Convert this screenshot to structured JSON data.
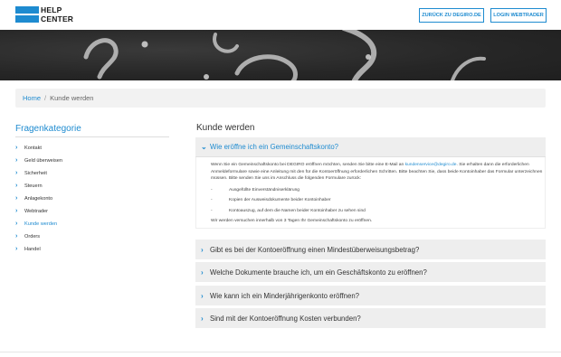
{
  "header": {
    "logo_line1": "HELP",
    "logo_line2": "CENTER",
    "btn_degiro": "ZURÜCK ZU DEGIRO.DE",
    "btn_login": "LOGIN WEBTRADER"
  },
  "breadcrumb": {
    "home": "Home",
    "separator": "/",
    "current": "Kunde werden"
  },
  "sidebar": {
    "title": "Fragenkategorie",
    "items": [
      {
        "label": "Kontakt"
      },
      {
        "label": "Geld überweisen"
      },
      {
        "label": "Sicherheit"
      },
      {
        "label": "Steuern"
      },
      {
        "label": "Anlagekonto"
      },
      {
        "label": "Webtrader"
      },
      {
        "label": "Kunde werden",
        "active": true
      },
      {
        "label": "Orders"
      },
      {
        "label": "Handel"
      }
    ]
  },
  "main": {
    "title": "Kunde werden",
    "faq": [
      {
        "question": "Wie eröffne ich ein Gemeinschaftskonto?",
        "open": true,
        "body_pre": "Wenn Sie ein Gemeinschaftskonto bei DEGIRO eröffnen möchten, senden Sie bitte eine E-Mail an ",
        "email": "kundenservice@degiro.de",
        "body_post": ". Sie erhalten dann die erforderlichen Anmeldeformulare sowie eine Anleitung mit den für die Kontoeröffnung erforderlichen Schritten. Bitte beachten Sie, dass beide Kontoinhaber das Formular unterzeichnen müssen. Bitte senden Sie uns im Anschluss die folgenden Formulare zurück:",
        "list": [
          "Ausgefüllte Einverständniserklärung",
          "Kopien der Ausweisdokumente beider Kontoinhaber",
          "Kontoauszug, auf dem die Namen beider Kontoinhaber zu sehen sind"
        ],
        "list_dash": "-",
        "closing": "Wir werden versuchen innerhalb von 3 Tagen Ihr Gemeinschaftskonto  zu eröffnen."
      },
      {
        "question": "Gibt es bei der Kontoeröffnung einen Mindestüberweisungsbetrag?"
      },
      {
        "question": "Welche Dokumente brauche ich, um ein Geschäftskonto zu eröffnen?"
      },
      {
        "question": "Wie kann ich ein Minderjährigenkonto eröffnen?"
      },
      {
        "question": "Sind mit der Kontoeröffnung Kosten verbunden?"
      }
    ]
  },
  "icons": {
    "chevron_right": "›",
    "chevron_down": "⌄"
  },
  "colors": {
    "accent": "#1e8bd0",
    "panel_bg": "#eeeeee",
    "hero_bg": "#262626"
  }
}
